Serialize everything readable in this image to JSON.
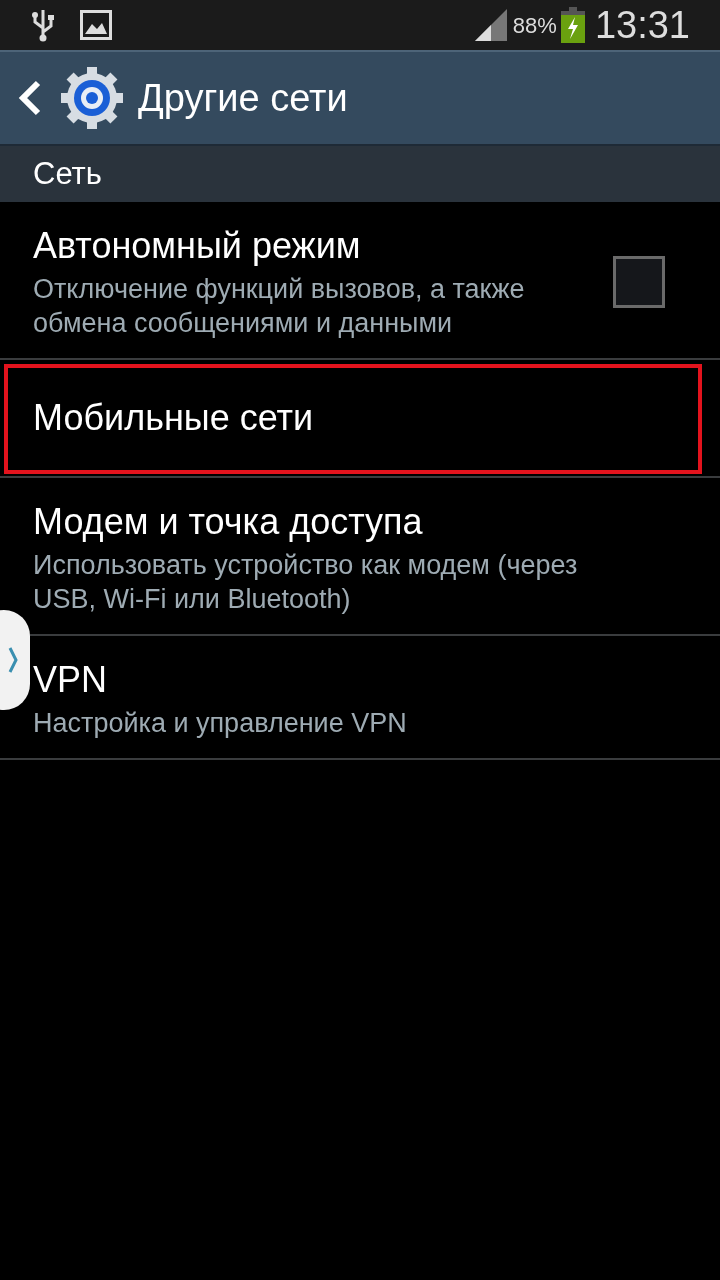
{
  "status_bar": {
    "battery_text": "88%",
    "time": "13:31"
  },
  "header": {
    "title": "Другие сети"
  },
  "section": {
    "title": "Сеть"
  },
  "items": [
    {
      "kind": "checkbox",
      "title": "Автономный режим",
      "subtitle": "Отключение функций вызовов, а также обмена сообщениями и данными",
      "checked": false,
      "highlighted": false
    },
    {
      "kind": "plain",
      "title": "Мобильные сети",
      "highlighted": true
    },
    {
      "kind": "plain",
      "title": "Модем и точка доступа",
      "subtitle": "Использовать устройство как модем (через USB, Wi-Fi или Bluetooth)",
      "highlighted": false
    },
    {
      "kind": "plain",
      "title": "VPN",
      "subtitle": "Настройка и управление VPN",
      "highlighted": false
    }
  ]
}
